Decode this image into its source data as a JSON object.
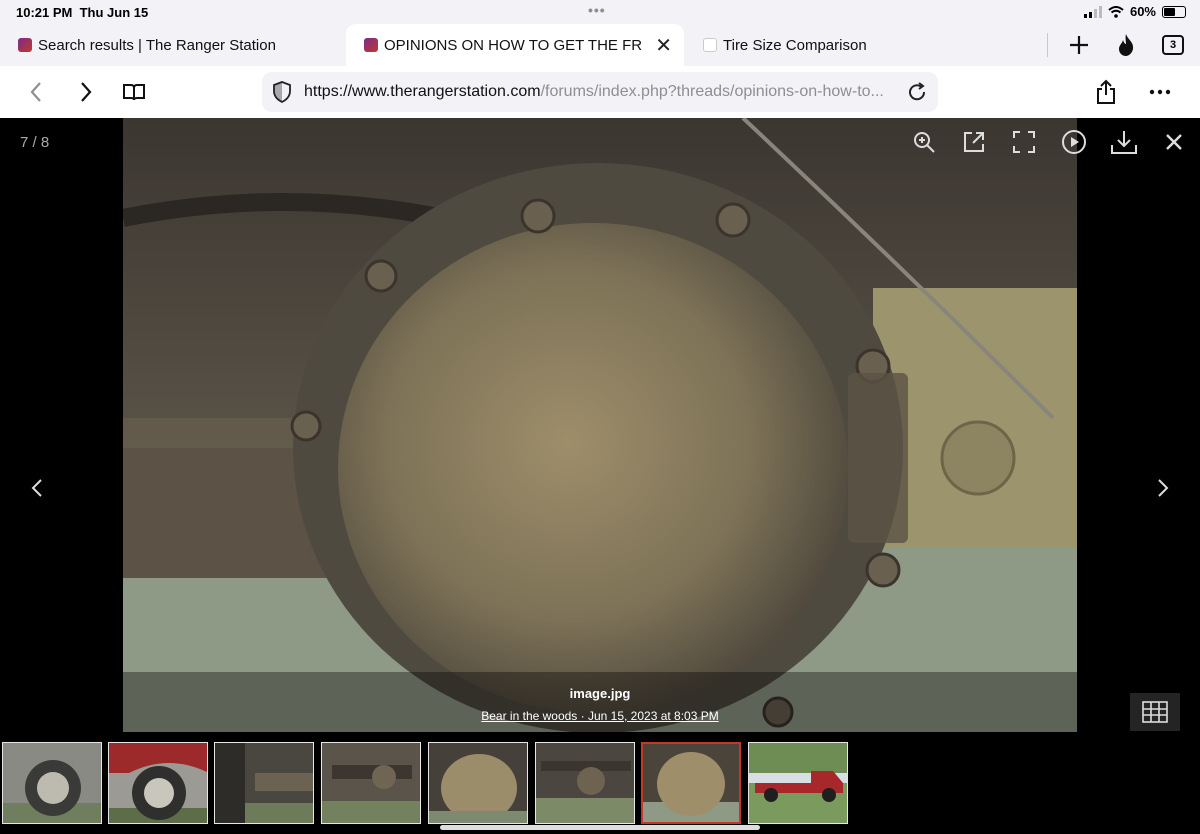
{
  "status": {
    "time": "10:21 PM",
    "date": "Thu Jun 15",
    "battery": "60%",
    "battery_level": 0.6
  },
  "tabs": [
    {
      "title": "Search results | The Ranger Station",
      "active": false
    },
    {
      "title": "OPINIONS ON HOW TO GET THE FR",
      "active": true
    },
    {
      "title": "Tire Size Comparison",
      "active": false
    }
  ],
  "tab_count": "3",
  "url": {
    "domain": "https://www.therangerstation.com",
    "path": "/forums/index.php?threads/opinions-on-how-to..."
  },
  "viewer": {
    "counter": "7 / 8",
    "caption_title": "image.jpg",
    "caption_meta": "Bear in the woods · Jun 15, 2023 at 8:03 PM"
  },
  "icons": {
    "back": "chevron-left-icon",
    "forward": "chevron-right-icon",
    "reader": "book-icon",
    "shield": "shield-icon",
    "reload": "reload-icon",
    "share": "share-icon",
    "more": "more-icon",
    "zoom": "zoom-in-icon",
    "open_external": "external-link-icon",
    "fullscreen": "fullscreen-icon",
    "slideshow": "play-icon",
    "download": "download-icon",
    "close": "close-icon",
    "grid": "grid-icon"
  },
  "colors": {
    "chrome": "#f2f2f7",
    "active_thumb_border": "#c0392b"
  }
}
